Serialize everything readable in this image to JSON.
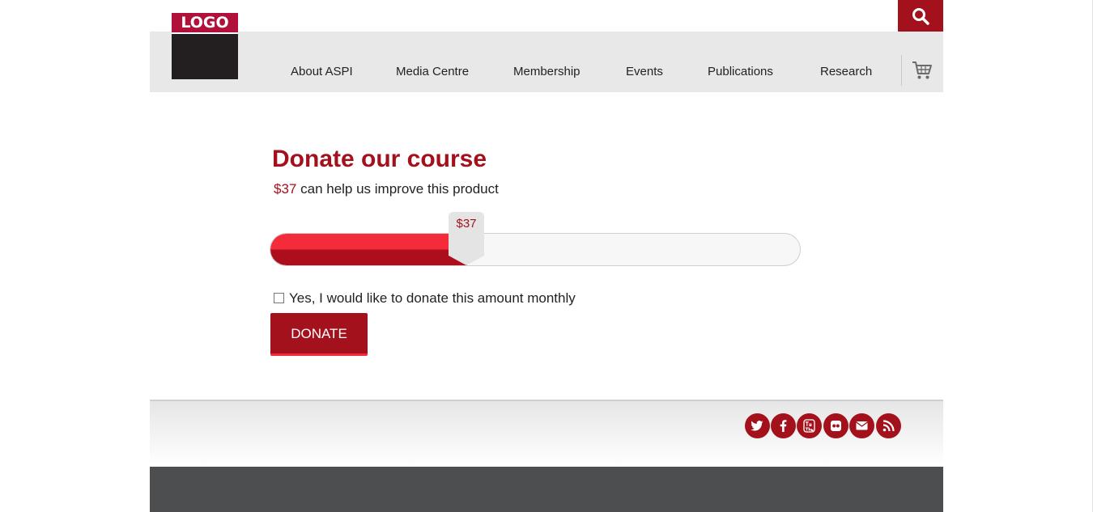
{
  "header": {
    "logo_text": "LOGO",
    "nav": [
      "About ASPI",
      "Media Centre",
      "Membership",
      "Events",
      "Publications",
      "Research"
    ],
    "icons": {
      "search": "search-icon",
      "cart": "cart-icon"
    }
  },
  "donation": {
    "title": "Donate our course",
    "amount": "$37",
    "subtitle_text": "can help us improve this product",
    "slider_fraction": 0.37,
    "slider_label": "$37",
    "monthly_label": "Yes, I would like to donate this amount monthly",
    "monthly_checked": false,
    "button_label": "DONATE"
  },
  "footer": {
    "social_icons": [
      "twitter-icon",
      "facebook-icon",
      "youtube-icon",
      "flickr-icon",
      "email-icon",
      "rss-icon"
    ]
  },
  "colors": {
    "brand": "#a3111d",
    "brand_light": "#f42b3a",
    "header_bg": "#e8e8e8",
    "footer_dark": "#4d4e50"
  }
}
